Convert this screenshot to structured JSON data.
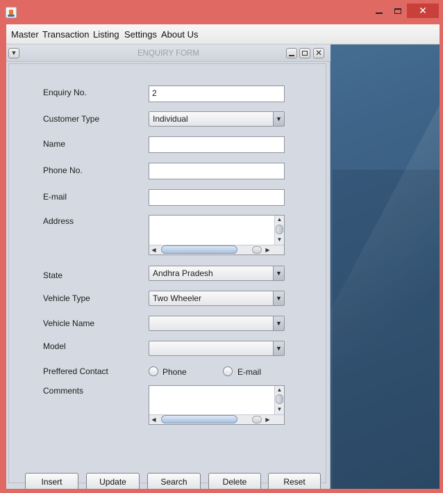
{
  "window": {
    "minimize_label": "_",
    "maximize_label": "□",
    "close_label": "✕"
  },
  "menu": {
    "items": [
      "Master",
      "Transaction",
      "Listing",
      "Settings",
      "About Us"
    ]
  },
  "form": {
    "title": "ENQUIRY FORM",
    "labels": {
      "enquiry_no": "Enquiry No.",
      "customer_type": "Customer Type",
      "name": "Name",
      "phone": "Phone No.",
      "email": "E-mail",
      "address": "Address",
      "state": "State",
      "vehicle_type": "Vehicle Type",
      "vehicle_name": "Vehicle Name",
      "model": "Model",
      "preferred_contact": "Preffered Contact",
      "comments": "Comments"
    },
    "values": {
      "enquiry_no": "2",
      "customer_type": "Individual",
      "name": "",
      "phone": "",
      "email": "",
      "address": "",
      "state": "Andhra Pradesh",
      "vehicle_type": "Two Wheeler",
      "vehicle_name": "",
      "model": "",
      "comments": ""
    },
    "contact_options": [
      "Phone",
      "E-mail"
    ],
    "buttons": [
      "Insert",
      "Update",
      "Search",
      "Delete",
      "Reset"
    ]
  },
  "colors": {
    "window_frame": "#e06a63",
    "desktop": "#3e6488",
    "form_bg": "#d5d9e1"
  }
}
